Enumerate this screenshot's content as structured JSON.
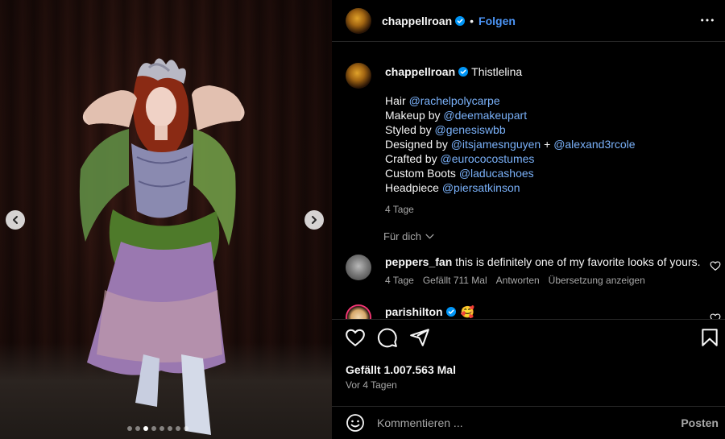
{
  "header": {
    "username": "chappellroan",
    "separator": "•",
    "follow_label": "Folgen",
    "more_icon": "more-dots-icon"
  },
  "media": {
    "carousel_total": 8,
    "carousel_active_index": 2
  },
  "caption": {
    "username": "chappellroan",
    "title": "Thistlelina",
    "lines": [
      {
        "prefix": "Hair ",
        "mention": "@rachelpolycarpe",
        "middle": "",
        "mention2": ""
      },
      {
        "prefix": "Makeup by ",
        "mention": "@deemakeupart",
        "middle": "",
        "mention2": ""
      },
      {
        "prefix": "Styled by ",
        "mention": "@genesiswbb",
        "middle": "",
        "mention2": ""
      },
      {
        "prefix": "Designed by ",
        "mention": "@itsjamesnguyen",
        "middle": " + ",
        "mention2": "@alexand3rcole"
      },
      {
        "prefix": "Crafted by ",
        "mention": "@eurococostumes",
        "middle": "",
        "mention2": ""
      },
      {
        "prefix": "Custom Boots ",
        "mention": "@laducashoes",
        "middle": "",
        "mention2": ""
      },
      {
        "prefix": "Headpiece ",
        "mention": "@piersatkinson",
        "middle": "",
        "mention2": ""
      }
    ],
    "age": "4 Tage"
  },
  "for_you": {
    "label": "Für dich"
  },
  "comments": [
    {
      "username": "peppers_fan",
      "text": "this is definitely one of my favorite looks of yours.",
      "age": "4 Tage",
      "likes": "Gefällt 711 Mal",
      "reply": "Antworten",
      "translate": "Übersetzung anzeigen"
    },
    {
      "username": "parishilton",
      "text": "🥰"
    }
  ],
  "actions": {
    "like_icon": "heart-icon",
    "comment_icon": "comment-icon",
    "share_icon": "share-icon",
    "save_icon": "bookmark-icon"
  },
  "stats": {
    "likes": "Gefällt 1.007.563 Mal",
    "date": "Vor 4 Tagen"
  },
  "composer": {
    "placeholder": "Kommentieren ...",
    "post_label": "Posten"
  },
  "colors": {
    "accent": "#4c95f6",
    "mention": "#7ab1f9",
    "muted": "#a8a8a8",
    "background": "#000000"
  }
}
